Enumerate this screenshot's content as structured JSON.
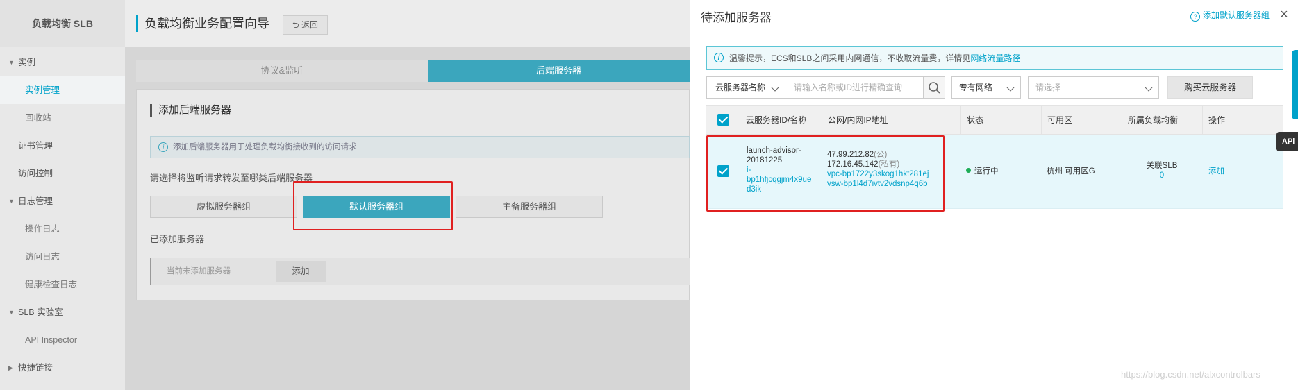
{
  "sidebar": {
    "brand": "负载均衡 SLB",
    "items": [
      {
        "label": "实例",
        "level": 1,
        "caret": "▼"
      },
      {
        "label": "实例管理",
        "level": 2,
        "active": true
      },
      {
        "label": "回收站",
        "level": 2
      },
      {
        "label": "证书管理",
        "level": 1
      },
      {
        "label": "访问控制",
        "level": 1
      },
      {
        "label": "日志管理",
        "level": 1,
        "caret": "▼"
      },
      {
        "label": "操作日志",
        "level": 2
      },
      {
        "label": "访问日志",
        "level": 2
      },
      {
        "label": "健康检查日志",
        "level": 2
      },
      {
        "label": "SLB 实验室",
        "level": 1,
        "caret": "▼"
      },
      {
        "label": "API Inspector",
        "level": 2
      },
      {
        "label": "快捷链接",
        "level": 1,
        "caret": "▶"
      }
    ]
  },
  "wizard": {
    "title": "负载均衡业务配置向导",
    "back_label": "返回",
    "back_icon": "⮌",
    "steps": [
      "协议&监听",
      "后端服务器"
    ],
    "card_title": "添加后端服务器",
    "notice": "添加后端服务器用于处理负载均衡接收到的访问请求",
    "question": "请选择将监听请求转发至哪类后端服务器",
    "groups": [
      "虚拟服务器组",
      "默认服务器组",
      "主备服务器组"
    ],
    "added_label": "已添加服务器",
    "empty_text": "当前未添加服务器",
    "add_label": "添加"
  },
  "drawer": {
    "title": "待添加服务器",
    "help_link": "添加默认服务器组",
    "close_icon": "×",
    "tip_text": "温馨提示，ECS和SLB之间采用内网通信，不收取流量费，详情见",
    "tip_link": "网络流量路径",
    "filter_select": "云服务器名称",
    "search_placeholder": "请输入名称或ID进行精确查询",
    "network_select": "专有网络",
    "vpc_placeholder": "请选择",
    "buy_button": "购买云服务器",
    "columns": [
      "云服务器ID/名称",
      "公网/内网IP地址",
      "状态",
      "可用区",
      "所属负载均衡",
      "操作"
    ],
    "rows": [
      {
        "name_lines": [
          "launch-advisor-",
          "20181225"
        ],
        "id_lines": [
          "i-",
          "bp1hfjcqgjm4x9ue",
          "d3ik"
        ],
        "public_ip": "47.99.212.82",
        "public_tag": "(公)",
        "private_ip": "172.16.45.142",
        "private_tag": "(私有)",
        "vpc": "vpc-bp1722y3skog1hkt281ej",
        "vsw": "vsw-bp1l4d7ivtv2vdsnp4q6b",
        "status": "运行中",
        "zone": "杭州 可用区G",
        "slb_label": "关联SLB",
        "slb_count": "0",
        "action": "添加"
      }
    ]
  },
  "api_tab": "APi",
  "watermark": "https://blog.csdn.net/alxcontrolbars",
  "colors": {
    "accent": "#00a2ca",
    "step_active": "#3ba6bd",
    "highlight": "#e02020",
    "status_running": "#1ead57"
  }
}
